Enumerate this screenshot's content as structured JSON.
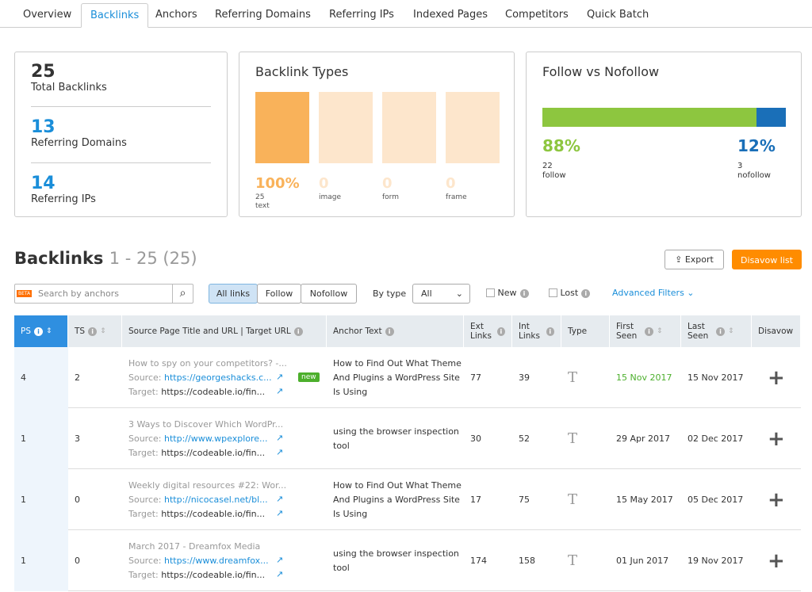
{
  "tabs": [
    "Overview",
    "Backlinks",
    "Anchors",
    "Referring Domains",
    "Referring IPs",
    "Indexed Pages",
    "Competitors",
    "Quick Batch"
  ],
  "summary": {
    "total": "25",
    "total_label": "Total Backlinks",
    "domains": "13",
    "domains_label": "Referring Domains",
    "ips": "14",
    "ips_label": "Referring IPs"
  },
  "types": {
    "title": "Backlink Types",
    "items": [
      {
        "pct": "100%",
        "count": "25",
        "label": "text",
        "fill": 1
      },
      {
        "pct": "0",
        "count": "",
        "label": "image",
        "fill": 0
      },
      {
        "pct": "0",
        "count": "",
        "label": "form",
        "fill": 0
      },
      {
        "pct": "0",
        "count": "",
        "label": "frame",
        "fill": 0
      }
    ]
  },
  "follow": {
    "title": "Follow vs Nofollow",
    "follow_pct": "88%",
    "follow_count": "22",
    "follow_label": "follow",
    "nofollow_pct": "12%",
    "nofollow_count": "3",
    "nofollow_label": "nofollow",
    "follow_fraction": 0.88,
    "colors": {
      "follow": "#8dc63f",
      "nofollow": "#1a6fb8"
    }
  },
  "section": {
    "title": "Backlinks",
    "range": "1 - 25 (25)",
    "export": "Export",
    "disavow": "Disavow list"
  },
  "filters": {
    "beta": "BETA",
    "search_placeholder": "Search by anchors",
    "all": "All links",
    "follow": "Follow",
    "nofollow": "Nofollow",
    "by_type": "By type",
    "type_value": "All",
    "new": "New",
    "lost": "Lost",
    "advanced": "Advanced Filters"
  },
  "columns": [
    "PS",
    "TS",
    "Source Page Title and URL | Target URL",
    "Anchor Text",
    "Ext Links",
    "Int Links",
    "Type",
    "First Seen",
    "Last Seen",
    "Disavow"
  ],
  "labels": {
    "source": "Source:",
    "target": "Target:",
    "new_badge": "new"
  },
  "rows": [
    {
      "ps": "4",
      "ts": "2",
      "title": "How to spy on your competitors? -...",
      "source": "https://georgeshacks.c...",
      "target": "https://codeable.io/fin...",
      "is_new": true,
      "anchor": "How to Find Out What Theme And Plugins a WordPress Site Is Using",
      "ext": "77",
      "int": "39",
      "first": "15 Nov 2017",
      "last": "15 Nov 2017"
    },
    {
      "ps": "1",
      "ts": "3",
      "title": "3 Ways to Discover Which WordPr...",
      "source": "http://www.wpexplore...",
      "target": "https://codeable.io/fin...",
      "is_new": false,
      "anchor": "using the browser inspection tool",
      "ext": "30",
      "int": "52",
      "first": "29 Apr 2017",
      "last": "02 Dec 2017"
    },
    {
      "ps": "1",
      "ts": "0",
      "title": "Weekly digital resources #22: Wor...",
      "source": "http://nicocasel.net/bl...",
      "target": "https://codeable.io/fin...",
      "is_new": false,
      "anchor": "How to Find Out What Theme And Plugins a WordPress Site Is Using",
      "ext": "17",
      "int": "75",
      "first": "15 May 2017",
      "last": "05 Dec 2017"
    },
    {
      "ps": "1",
      "ts": "0",
      "title": "March 2017 - Dreamfox Media",
      "source": "https://www.dreamfox...",
      "target": "https://codeable.io/fin...",
      "is_new": false,
      "anchor": "using the browser inspection tool",
      "ext": "174",
      "int": "158",
      "first": "01 Jun 2017",
      "last": "19 Nov 2017"
    }
  ]
}
